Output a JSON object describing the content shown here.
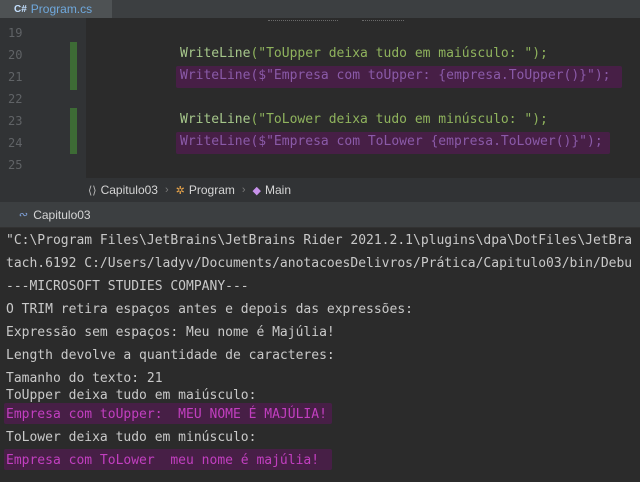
{
  "editor_tab": {
    "icon_text": "C#",
    "label": "Program.cs"
  },
  "editor": {
    "line_numbers": [
      "19",
      "20",
      "21",
      "22",
      "23",
      "24",
      "25"
    ],
    "lines": [
      {
        "fn": "WriteLine",
        "rest": "(\"ToUpper deixa tudo em maiúsculo: \");"
      },
      {
        "fn": "WriteLine",
        "rest": "($\"Empresa com toUpper: {empresa.ToUpper()}\");"
      },
      {
        "fn": "WriteLine",
        "rest": "(\"ToLower deixa tudo em minúsculo: \");"
      },
      {
        "fn": "WriteLine",
        "rest": "($\"Empresa com ToLower {empresa.ToLower()}\");"
      }
    ]
  },
  "breadcrumb": {
    "items": [
      {
        "icon": "⟨⟩",
        "label": "Capitulo03"
      },
      {
        "icon": "✲",
        "label": "Program"
      },
      {
        "icon": "◆",
        "label": "Main"
      }
    ],
    "separator": "›"
  },
  "run_window": {
    "tab_label": "Capitulo03"
  },
  "console": {
    "lines": [
      "\"C:\\Program Files\\JetBrains\\JetBrains Rider 2021.2.1\\plugins\\dpa\\DotFiles\\JetBra",
      "tach.6192 C:/Users/ladyv/Documents/anotacoesDelivros/Prática/Capitulo03/bin/Debu",
      "---MICROSOFT STUDIES COMPANY---",
      "O TRIM retira espaços antes e depois das expressões:",
      "Expressão sem espaços: Meu nome é Majúlia!",
      "Length devolve a quantidade de caracteres:",
      "Tamanho do texto: 21",
      "ToUpper deixa tudo em maiúsculo:",
      "Empresa com toUpper:  MEU NOME É MAJÚLIA!",
      "ToLower deixa tudo em minúsculo:",
      "Empresa com ToLower  meu nome é majúlia!"
    ]
  },
  "colors": {
    "accent_magenta": "#c23fc0",
    "highlight_bg": "#471f46",
    "function_green": "#a6c78b"
  }
}
